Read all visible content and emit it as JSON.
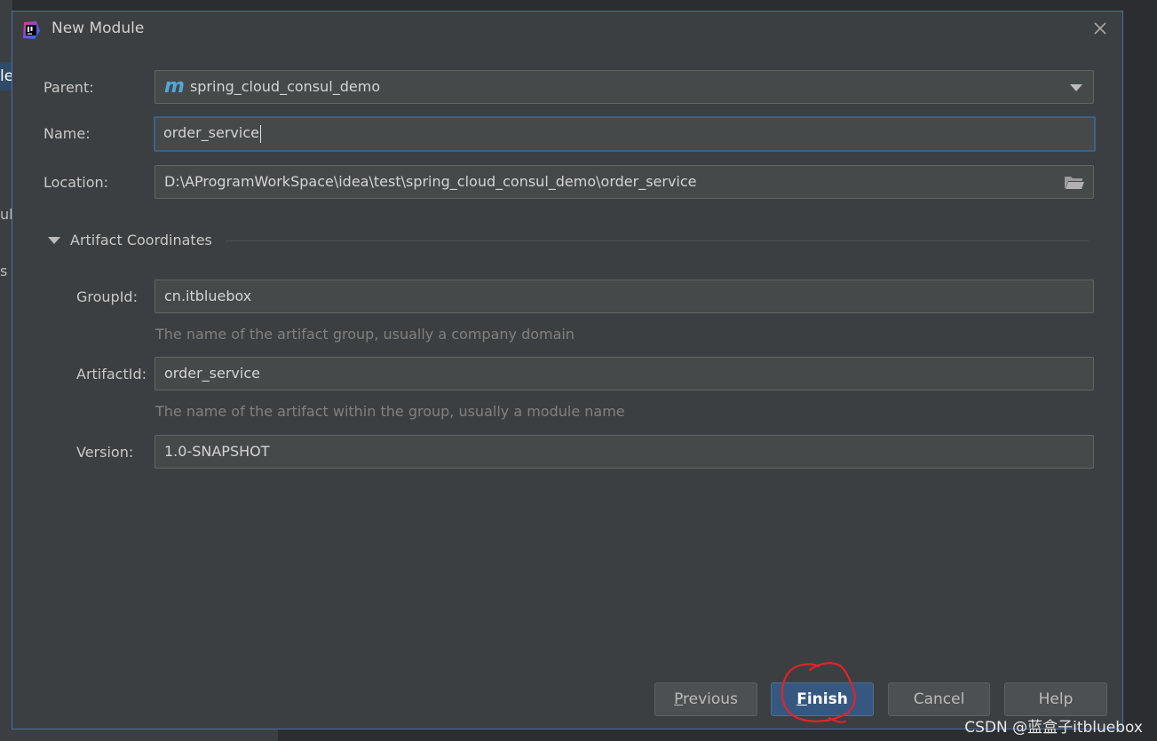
{
  "background": {
    "fragments": [
      "le",
      "ul_",
      "s"
    ]
  },
  "dialog": {
    "title": "New Module",
    "icons": {
      "app": "intellij-app-icon",
      "close": "close-icon"
    }
  },
  "form": {
    "parent_label": "Parent:",
    "parent_value": "spring_cloud_consul_demo",
    "parent_badge": "m",
    "name_label": "Name:",
    "name_value": "order_service",
    "location_label": "Location:",
    "location_value": "D:\\AProgramWorkSpace\\idea\\test\\spring_cloud_consul_demo\\order_service"
  },
  "artifact": {
    "section_title": "Artifact Coordinates",
    "groupid_label": "GroupId:",
    "groupid_value": "cn.itbluebox",
    "groupid_hint": "The name of the artifact group, usually a company domain",
    "artifactid_label": "ArtifactId:",
    "artifactid_value": "order_service",
    "artifactid_hint": "The name of the artifact within the group, usually a module name",
    "version_label": "Version:",
    "version_value": "1.0-SNAPSHOT"
  },
  "buttons": {
    "previous_mnemonic": "P",
    "previous_rest": "revious",
    "finish_mnemonic": "F",
    "finish_rest": "inish",
    "cancel": "Cancel",
    "help": "Help"
  },
  "watermark": "CSDN @蓝盒子itbluebox",
  "colors": {
    "dialog_bg": "#3c3f41",
    "field_bg": "#45494a",
    "focus_border": "#3d6185",
    "primary_button": "#365880",
    "maven_accent": "#4fa8d8",
    "annotation_red": "#e0242a"
  }
}
